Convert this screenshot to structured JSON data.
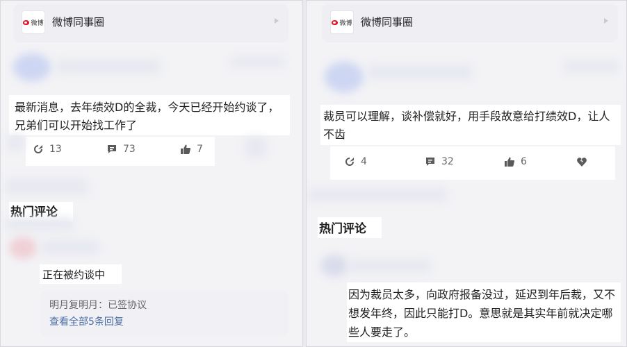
{
  "left": {
    "topic_name": "微博同事圈",
    "logo_text": "微博",
    "post_text": "最新消息，去年绩效D的全裁，今天已经开始约谈了，兄弟们可以开始找工作了",
    "repost_count": "13",
    "comment_count": "73",
    "like_count": "7",
    "hot_comments_label": "热门评论",
    "comment_snippet": "正在被约谈中",
    "sub_reply": "明月复明月：已签协议",
    "view_all_replies": "查看全部5条回复"
  },
  "right": {
    "topic_name": "微博同事圈",
    "logo_text": "微博",
    "post_text": "裁员可以理解，谈补偿就好，用手段故意给打绩效D，让人不齿",
    "repost_count": "4",
    "comment_count": "32",
    "like_count": "6",
    "hot_comments_label": "热门评论",
    "comment_text": "因为裁员太多，向政府报备没过，延迟到年后裁，又不想发年终，因此只能打D。意思就是其实年前就决定哪些人要走了。"
  },
  "colors": {
    "weibo_red": "#e6162d",
    "icon_gray": "#5a5a5a",
    "link_blue": "#4a6fa5"
  },
  "icons": [
    "repost-icon",
    "comment-icon",
    "like-icon",
    "broken-heart-icon",
    "chevron-right-icon"
  ]
}
